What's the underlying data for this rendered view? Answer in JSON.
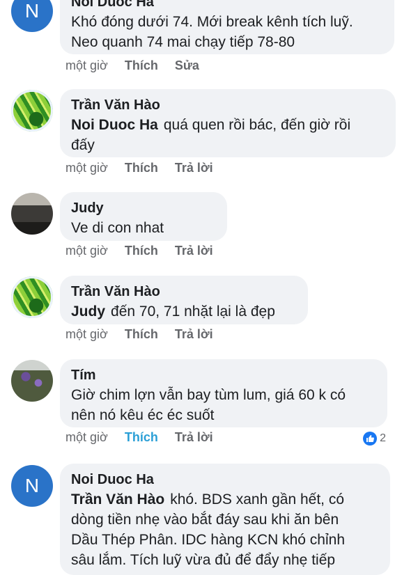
{
  "comments": [
    {
      "author": "Noi Duoc Ha",
      "lines": [
        "Khó đóng dưới 74. Mới break kênh tích luỹ.",
        "Neo quanh 74 mai chạy tiếp 78-80"
      ],
      "time": "một giờ",
      "like_label": "Thích",
      "action_label": "Sửa",
      "avatar_letter": "N"
    },
    {
      "author": "Trần Văn Hào",
      "mention": "Noi Duoc Ha",
      "lines": [
        "quá quen rồi bác, đến giờ rồi",
        "đấy"
      ],
      "time": "một giờ",
      "like_label": "Thích",
      "action_label": "Trả lời"
    },
    {
      "author": "Judy",
      "lines": [
        "Ve di con nhat"
      ],
      "time": "một giờ",
      "like_label": "Thích",
      "action_label": "Trả lời"
    },
    {
      "author": "Trần Văn Hào",
      "mention": "Judy",
      "lines": [
        "đến 70, 71 nhặt lại là đẹp"
      ],
      "time": "một giờ",
      "like_label": "Thích",
      "action_label": "Trả lời"
    },
    {
      "author": "Tím",
      "lines": [
        "Giờ chim lợn vẫn bay tùm lum, giá 60 k có",
        "nên nó kêu éc éc suốt"
      ],
      "time": "một giờ",
      "like_label": "Thích",
      "action_label": "Trả lời",
      "like_count": "2"
    },
    {
      "author": "Noi Duoc Ha",
      "mention": "Trần Văn Hào",
      "lines": [
        "khó. BDS xanh gần hết, có",
        "dòng tiền nhẹ vào bắt đáy sau khi ăn bên",
        "Dầu Thép Phân. IDC hàng KCN khó chỉnh",
        "sâu lắm. Tích luỹ vừa đủ để đẩy nhẹ tiếp"
      ],
      "avatar_letter": "N"
    }
  ],
  "colors": {
    "accent": "#1877f2",
    "liked": "#2a9fd6",
    "bubble": "#f0f2f5",
    "meta": "#65676b"
  },
  "icons": {
    "like_reaction": "thumbs-up-icon"
  }
}
